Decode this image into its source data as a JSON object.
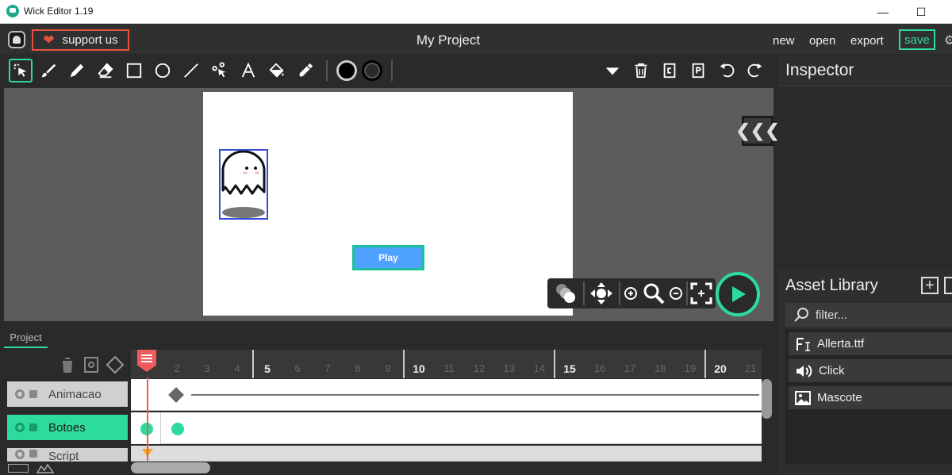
{
  "os": {
    "title": "Wick Editor 1.19",
    "minimize": "—",
    "maximize": "☐"
  },
  "topbar": {
    "support": "support us",
    "project_title": "My Project",
    "new": "new",
    "open": "open",
    "export": "export",
    "save": "save"
  },
  "stage": {
    "play_button": "Play"
  },
  "inspector": {
    "title": "Inspector"
  },
  "assets": {
    "title": "Asset Library",
    "add": "+",
    "filter_placeholder": "filter...",
    "items": [
      {
        "name": "Allerta.ttf",
        "icon": "font-icon"
      },
      {
        "name": "Click",
        "icon": "sound-icon"
      },
      {
        "name": "Mascote",
        "icon": "image-icon"
      }
    ]
  },
  "timeline": {
    "tab": "Project",
    "ticks": [
      "2",
      "3",
      "4",
      "5",
      "6",
      "7",
      "8",
      "9",
      "10",
      "11",
      "12",
      "13",
      "14",
      "15",
      "16",
      "17",
      "18",
      "19",
      "20",
      "21"
    ],
    "layers": [
      {
        "name": "Animacao",
        "active": false
      },
      {
        "name": "Botoes",
        "active": true
      },
      {
        "name": "Script",
        "active": false
      }
    ]
  },
  "colors": {
    "accent": "#2ddc9c",
    "support_border": "#e6533d",
    "playhead": "#ef5b5b",
    "stage_button": "#4fa2ff"
  }
}
